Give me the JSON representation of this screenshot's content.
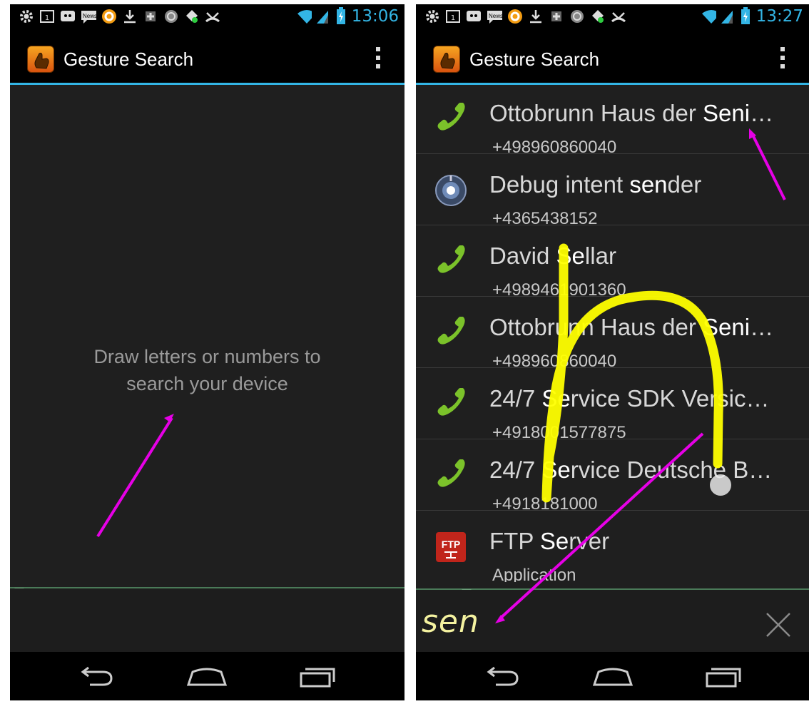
{
  "left_screen": {
    "status": {
      "time": "13:06",
      "news_badge": "News"
    },
    "app_title": "Gesture Search",
    "empty_message_line1": "Draw letters or numbers to",
    "empty_message_line2": "search your device"
  },
  "right_screen": {
    "status": {
      "time": "13:27",
      "news_badge": "News"
    },
    "app_title": "Gesture Search",
    "results": [
      {
        "icon": "phone-icon",
        "name_pre": "Ottobrunn Haus der ",
        "name_hl": "Seni",
        "name_post": "…",
        "sub": "+498960860040"
      },
      {
        "icon": "debug-intent-icon",
        "name_pre": "Debug intent ",
        "name_hl": "sen",
        "name_post": "der",
        "sub": "+4365438152"
      },
      {
        "icon": "phone-icon",
        "name_pre": "David ",
        "name_hl": "Se",
        "name_post": "llar",
        "sub": "+4989461901360"
      },
      {
        "icon": "phone-icon",
        "name_pre": "Ottobrunn Haus der ",
        "name_hl": "Seni",
        "name_post": "…",
        "sub": "+498960860040"
      },
      {
        "icon": "phone-icon",
        "name_pre": "24/7 ",
        "name_hl": "Se",
        "name_post": "rvice SDK Versic…",
        "sub": "+4918001577875"
      },
      {
        "icon": "phone-icon",
        "name_pre": "24/7 ",
        "name_hl": "Se",
        "name_post": "rvice Deutsche B…",
        "sub": "+4918181000"
      },
      {
        "icon": "ftp-icon",
        "name_pre": "FTP ",
        "name_hl": "Se",
        "name_post": "rver",
        "sub": "Application"
      }
    ],
    "query": "sen",
    "ftp_icon_text": "FTP"
  },
  "colors": {
    "accent_blue": "#33b5e5",
    "annotation_magenta": "#e600e6",
    "gesture_yellow": "#ffff00",
    "phone_green": "#7bc22a"
  }
}
